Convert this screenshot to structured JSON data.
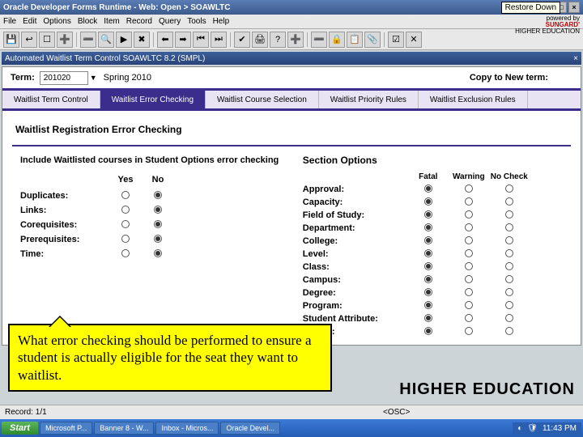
{
  "window": {
    "title": "Oracle Developer Forms Runtime - Web: Open > SOAWLTC",
    "restore_tip": "Restore Down"
  },
  "brand": {
    "line1": "powered by",
    "line2": "SUNGARD'",
    "line3": "HIGHER EDUCATION"
  },
  "menu": [
    "File",
    "Edit",
    "Options",
    "Block",
    "Item",
    "Record",
    "Query",
    "Tools",
    "Help"
  ],
  "inner_title": "Automated Waitlist Term Control  SOAWLTC  8.2  (SMPL)",
  "term": {
    "label": "Term:",
    "value": "201020",
    "name": "Spring 2010",
    "copy_label": "Copy to New term:"
  },
  "tabs": [
    "Waitlist Term Control",
    "Waitlist Error Checking",
    "Waitlist Course Selection",
    "Waitlist Priority Rules",
    "Waitlist Exclusion Rules"
  ],
  "active_tab": 1,
  "section_title": "Waitlist Registration Error Checking",
  "left": {
    "heading": "Include Waitlisted courses in Student Options error checking",
    "yes": "Yes",
    "no": "No",
    "rows": [
      {
        "label": "Duplicates:",
        "val": "no"
      },
      {
        "label": "Links:",
        "val": "no"
      },
      {
        "label": "Corequisites:",
        "val": "no"
      },
      {
        "label": "Prerequisites:",
        "val": "no"
      },
      {
        "label": "Time:",
        "val": "no"
      }
    ]
  },
  "right": {
    "heading": "Section Options",
    "cols": [
      "Fatal",
      "Warning",
      "No Check"
    ],
    "rows": [
      {
        "label": "Approval:",
        "val": 0
      },
      {
        "label": "Capacity:",
        "val": 0
      },
      {
        "label": "Field of Study:",
        "val": 0
      },
      {
        "label": "Department:",
        "val": 0
      },
      {
        "label": "College:",
        "val": 0
      },
      {
        "label": "Level:",
        "val": 0
      },
      {
        "label": "Class:",
        "val": 0
      },
      {
        "label": "Campus:",
        "val": 0
      },
      {
        "label": "Degree:",
        "val": 0
      },
      {
        "label": "Program:",
        "val": 0
      },
      {
        "label": "Student Attribute:",
        "val": 0
      },
      {
        "label": "Cohort:",
        "val": 0
      }
    ]
  },
  "callout": "What error checking should be performed to ensure a student is actually eligible for the seat they want to waitlist.",
  "status": {
    "record": "Record: 1/1",
    "osc": "<OSC>"
  },
  "big_edu": "HIGHER EDUCATION",
  "taskbar": {
    "start": "Start",
    "items": [
      "Microsoft P...",
      "Banner 8 - W...",
      "Inbox - Micros...",
      "Oracle Devel..."
    ],
    "time": "11:43 PM"
  },
  "toolbar_icons": [
    "save",
    "rollback",
    "select",
    "insert",
    "delete",
    "enter-q",
    "exec-q",
    "cancel-q",
    "prev",
    "next",
    "prev-blk",
    "next-blk",
    "commit",
    "print",
    "help",
    "add",
    "remove",
    "lock",
    "clipboard",
    "attach",
    "checkbox",
    "close-x"
  ]
}
